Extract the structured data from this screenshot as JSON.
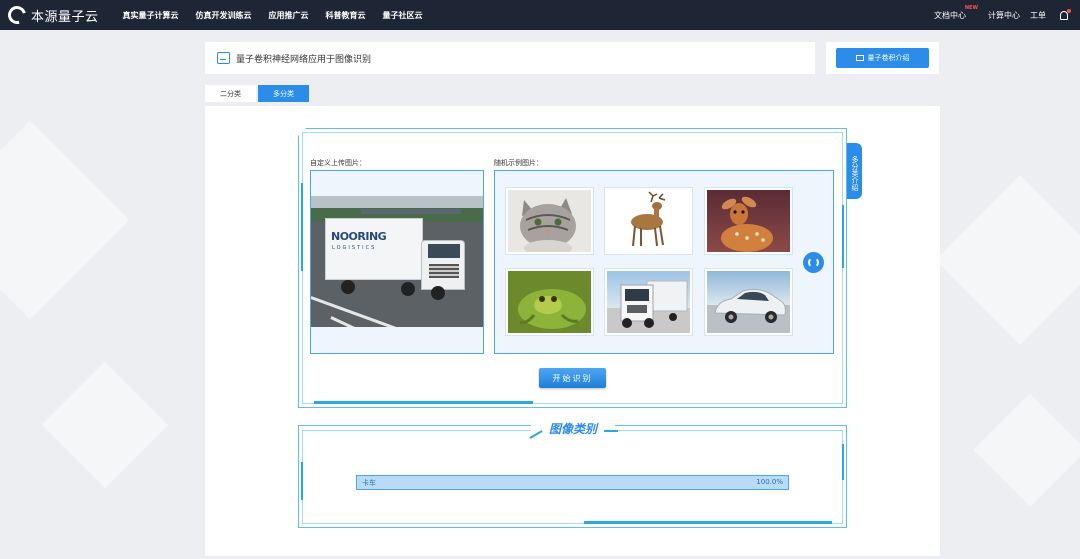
{
  "app": {
    "name": "本源量子云"
  },
  "nav": {
    "items": [
      "真实量子计算云",
      "仿真开发训练云",
      "应用推广云",
      "科普教育云",
      "量子社区云"
    ],
    "right": {
      "docs": "文档中心",
      "docs_badge": "NEW",
      "compute": "计算中心",
      "ticket": "工单"
    }
  },
  "page": {
    "title": "量子卷积神经网络应用于图像识别",
    "intro_button": "量子卷积介绍",
    "tabs": [
      {
        "label": "二分类",
        "active": false
      },
      {
        "label": "多分类",
        "active": true
      }
    ],
    "side_tab": "多分类介绍"
  },
  "upload": {
    "label": "自定义上传图片：",
    "image": {
      "subject": "truck",
      "trailer_text": "NOORING",
      "trailer_sub": "LOGISTICS"
    }
  },
  "random": {
    "label": "随机示例图片：",
    "thumbnails": [
      {
        "subject": "cat"
      },
      {
        "subject": "deer"
      },
      {
        "subject": "deer"
      },
      {
        "subject": "frog"
      },
      {
        "subject": "truck"
      },
      {
        "subject": "automobile"
      }
    ]
  },
  "start_button": "开始识别",
  "result": {
    "title": "图像类别",
    "items": [
      {
        "label": "卡车",
        "value": "100.0%",
        "fraction": 1.0
      }
    ]
  },
  "colors": {
    "accent": "#2b8cea",
    "topbar": "#1e2535",
    "frame": "#5fbfe8"
  }
}
